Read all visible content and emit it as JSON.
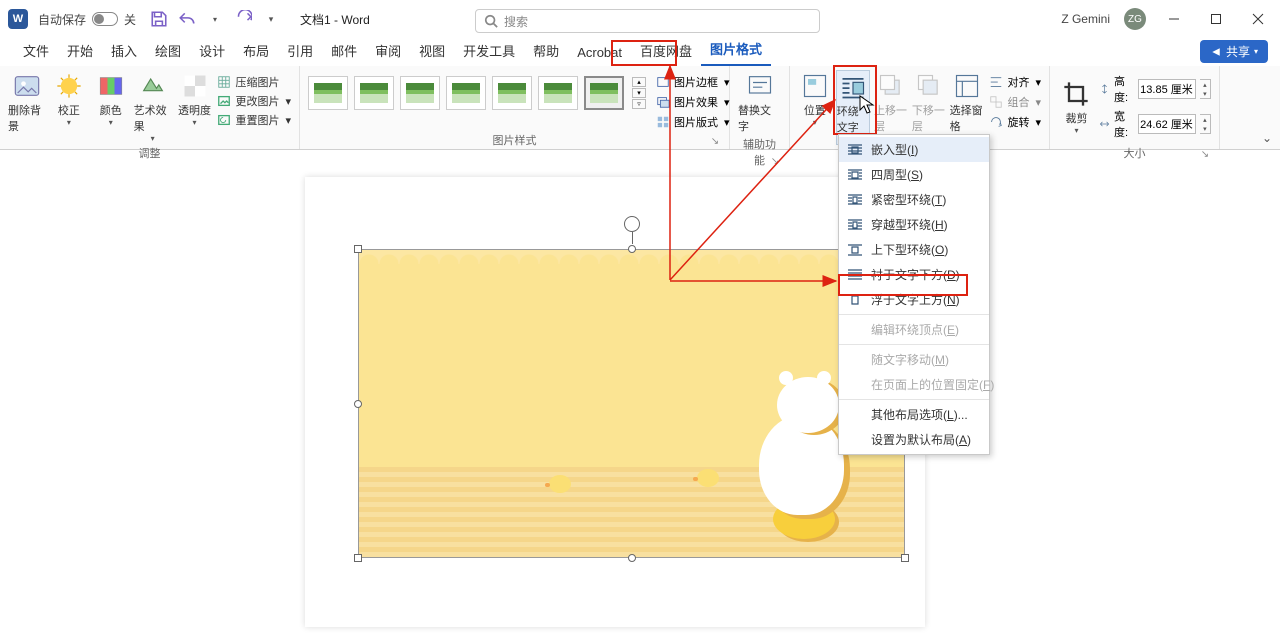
{
  "titlebar": {
    "autosave_label": "自动保存",
    "autosave_state": "关",
    "doc_title": "文档1 - Word",
    "search_placeholder": "搜索",
    "user_name": "Z Gemini",
    "user_initials": "ZG"
  },
  "tabs": {
    "items": [
      "文件",
      "开始",
      "插入",
      "绘图",
      "设计",
      "布局",
      "引用",
      "邮件",
      "审阅",
      "视图",
      "开发工具",
      "帮助",
      "Acrobat",
      "百度网盘",
      "图片格式"
    ],
    "active_index": 14,
    "share_label": "共享"
  },
  "ribbon": {
    "adjust": {
      "label": "调整",
      "remove_bg": "删除背景",
      "corrections": "校正",
      "color": "颜色",
      "artistic": "艺术效果",
      "transparency": "透明度",
      "compress": "压缩图片",
      "change": "更改图片",
      "reset": "重置图片"
    },
    "styles": {
      "label": "图片样式",
      "border": "图片边框",
      "effects": "图片效果",
      "layout": "图片版式"
    },
    "ax": {
      "label": "辅助功能",
      "alt_text": "替换文字"
    },
    "arrange": {
      "position": "位置",
      "wrap": "环绕文字",
      "forward": "上移一层",
      "backward": "下移一层",
      "selection_pane": "选择窗格",
      "align": "对齐",
      "group": "组合",
      "rotate": "旋转"
    },
    "size": {
      "label": "大小",
      "crop": "裁剪",
      "height_label": "高度:",
      "height_value": "13.85 厘米",
      "width_label": "宽度:",
      "width_value": "24.62 厘米"
    }
  },
  "dropdown": {
    "items": [
      {
        "label_pre": "嵌入型(",
        "u": "I",
        "label_post": ")",
        "disabled": false,
        "hover": true
      },
      {
        "label_pre": "四周型(",
        "u": "S",
        "label_post": ")",
        "disabled": false
      },
      {
        "label_pre": "紧密型环绕(",
        "u": "T",
        "label_post": ")",
        "disabled": false
      },
      {
        "label_pre": "穿越型环绕(",
        "u": "H",
        "label_post": ")",
        "disabled": false
      },
      {
        "label_pre": "上下型环绕(",
        "u": "O",
        "label_post": ")",
        "disabled": false
      },
      {
        "label_pre": "衬于文字下方(",
        "u": "D",
        "label_post": ")",
        "disabled": false
      },
      {
        "label_pre": "浮于文字上方(",
        "u": "N",
        "label_post": ")",
        "disabled": false
      },
      {
        "sep": true
      },
      {
        "label_pre": "编辑环绕顶点(",
        "u": "E",
        "label_post": ")",
        "disabled": true
      },
      {
        "sep": true
      },
      {
        "label_pre": "随文字移动(",
        "u": "M",
        "label_post": ")",
        "disabled": true,
        "noicon": true
      },
      {
        "label_pre": "在页面上的位置固定(",
        "u": "F",
        "label_post": ")",
        "disabled": true,
        "noicon": true
      },
      {
        "sep": true
      },
      {
        "label_pre": "其他布局选项(",
        "u": "L",
        "label_post": ")...",
        "disabled": false
      },
      {
        "label_pre": "设置为默认布局(",
        "u": "A",
        "label_post": ")",
        "disabled": false,
        "noicon": true
      }
    ]
  }
}
